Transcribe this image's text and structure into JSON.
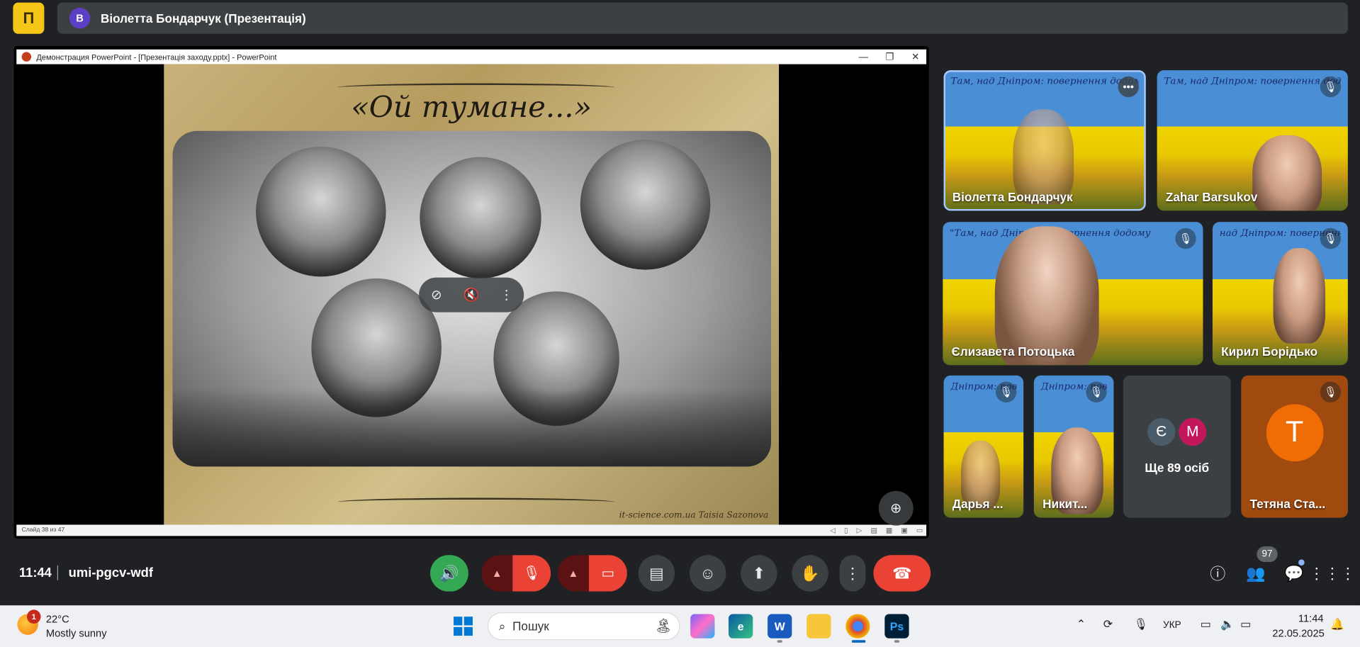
{
  "app": {
    "logo_letter": "П"
  },
  "presenter": {
    "avatar_letter": "В",
    "title": "Віолетта Бондарчук (Презентація)"
  },
  "powerpoint": {
    "window_title": "Демонстрация PowerPoint - [Презентація заходу.pptx] - PowerPoint",
    "status": "Слайд 38 из 47",
    "slide_title": "«Ой тумане...»",
    "slide_credit": "it-science.com.ua  Taisia Sazonova"
  },
  "participants": [
    {
      "name": "Віолетта Бондарчук",
      "banner": "Там, над Дніпром: повернення додому"
    },
    {
      "name": "Zahar Barsukov",
      "banner": "Там, над Дніпром: повернення додому"
    },
    {
      "name": "Єлизавета Потоцька",
      "banner": "\"Там, над Дніпром: повернення додому"
    },
    {
      "name": "Кирил Борідько",
      "banner": "над Дніпром: повернення"
    },
    {
      "name": "Дарья ...",
      "banner": "Дніпром: повернен"
    },
    {
      "name": "Никит...",
      "banner": "Дніпром: повернен"
    },
    {
      "name": "Тетяна Ста...",
      "initial": "T",
      "initial_color": "#f06d06"
    }
  ],
  "more_people": {
    "label": "Ще 89 осіб",
    "avatars": [
      {
        "letter": "Є",
        "color": "#4a5c6a"
      },
      {
        "letter": "M",
        "color": "#c2185b"
      }
    ]
  },
  "meeting": {
    "time": "11:44",
    "code": "umi-pgcv-wdf"
  },
  "controls": {
    "people_count": "97"
  },
  "taskbar": {
    "weather_badge": "1",
    "temperature": "22°C",
    "condition": "Mostly sunny",
    "search_placeholder": "Пошук",
    "language": "УКР",
    "time": "11:44",
    "date": "22.05.2025"
  }
}
